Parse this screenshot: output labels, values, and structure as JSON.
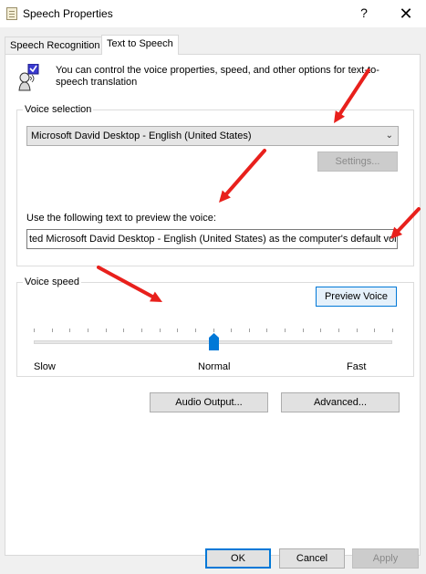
{
  "window": {
    "title": "Speech Properties",
    "help_glyph": "?",
    "close_glyph": "✕"
  },
  "tabs": [
    {
      "label": "Speech Recognition",
      "active": false
    },
    {
      "label": "Text to Speech",
      "active": true
    }
  ],
  "intro": {
    "text": "You can control the voice properties, speed, and other options for text-to-speech translation"
  },
  "voice_selection": {
    "legend": "Voice selection",
    "selected_voice": "Microsoft David Desktop - English (United States)",
    "settings_label": "Settings...",
    "settings_enabled": false,
    "preview_prompt": "Use the following text to preview the voice:",
    "preview_text": "ted Microsoft David Desktop - English (United States) as the computer's default voice.",
    "preview_button_label": "Preview Voice"
  },
  "voice_speed": {
    "legend": "Voice speed",
    "slow_label": "Slow",
    "normal_label": "Normal",
    "fast_label": "Fast",
    "tick_count": 21,
    "position_fraction": 0.5
  },
  "buttons": {
    "audio_output_label": "Audio Output...",
    "advanced_label": "Advanced...",
    "ok_label": "OK",
    "cancel_label": "Cancel",
    "apply_label": "Apply",
    "apply_enabled": false
  },
  "colors": {
    "annotation_arrow": "#e8201c",
    "focus_accent": "#0078d7",
    "slider_thumb": "#0078d7"
  },
  "icons": {
    "title_icon": "speech-properties-icon",
    "tts_icon": "speaking-person-checkmark-icon"
  }
}
